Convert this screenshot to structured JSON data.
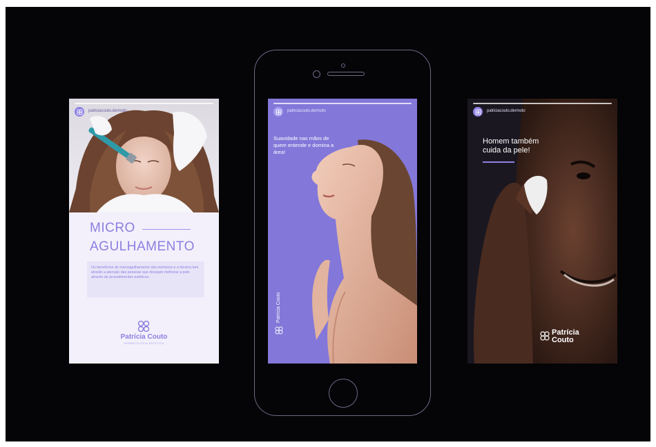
{
  "story_left": {
    "handle": "patriciacouto.dermoto",
    "title_line1": "MICRO",
    "title_line2": "AGULHAMENTO",
    "description": "Os benefícios do microagulhamento são inúmeros e a técnica tem atraído a atenção das pessoas que desejam melhorar a pele através de procedimentos estéticos.",
    "brand": "Patrícia Couto",
    "brand_sub": "DERMATOLOGIA ESTÉTICA"
  },
  "story_center": {
    "handle": "patriciacouto.dermoto",
    "tagline": "Suavidade nas mãos de quem entende e domina a área!",
    "brand_vertical": "Patrícia Couto"
  },
  "story_right": {
    "handle": "patriciacouto.dermoto",
    "headline": "Homem também cuida da pele!",
    "brand_line1": "Patrícia",
    "brand_line2": "Couto"
  },
  "colors": {
    "background": "#050407",
    "accent_lavender": "#8b7fe0",
    "phone_outline": "#6e6a86"
  }
}
